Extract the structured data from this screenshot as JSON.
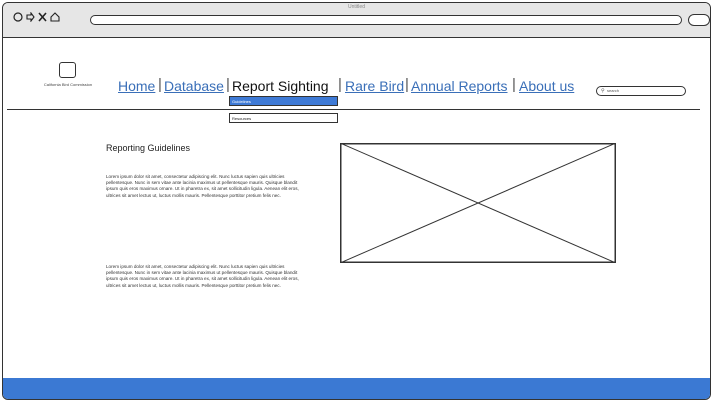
{
  "window": {
    "title": "Untitled"
  },
  "browser": {
    "back_icon": "circle-left",
    "forward_icon": "circle-right",
    "reload_icon": "ring",
    "close_icon": "x",
    "home_icon": "house",
    "url": ""
  },
  "logo": {
    "caption": "California Bird Commission"
  },
  "nav": {
    "home": "Home",
    "database": "Database",
    "report_sighting": "Report Sighting",
    "rare_bird": "Rare Bird",
    "annual_reports": "Annual Reports",
    "about_us": "About us"
  },
  "dropdown": {
    "items": [
      "Guidelines",
      "Resources"
    ]
  },
  "search": {
    "placeholder": "search"
  },
  "content": {
    "heading": "Reporting Guidelines",
    "paragraphs": [
      "Lorem ipsum dolor sit amet, consectetur adipiscing elit. Nunc luctus sapien quis ultricies pellentesque. Nunc in sem vitae ante lacinia maximus ut pellentesque mauris. Quisque blandit ipsum quis eros maximus ornare. Ut in pharetra ex, sit amet sollicitudin ligula. Aenean elit eros, ultrices sit amet lectus ut, luctus mollis mauris. Pellentesque porttitor pretium felis nec.",
      "Lorem ipsum dolor sit amet, consectetur adipiscing elit. Nunc luctus sapien quis ultricies pellentesque. Nunc in sem vitae ante lacinia maximus ut pellentesque mauris. Quisque blandit ipsum quis eros maximus ornare. Ut in pharetra ex, sit amet sollicitudin ligula. Aenean elit eros, ultrices sit amet lectus ut, luctus mollis mauris. Pellentesque porttitor pretium felis nec."
    ]
  },
  "colors": {
    "link": "#3a6fb8",
    "accent": "#3b79d3",
    "dropdown_active": "#3e7ad6"
  }
}
